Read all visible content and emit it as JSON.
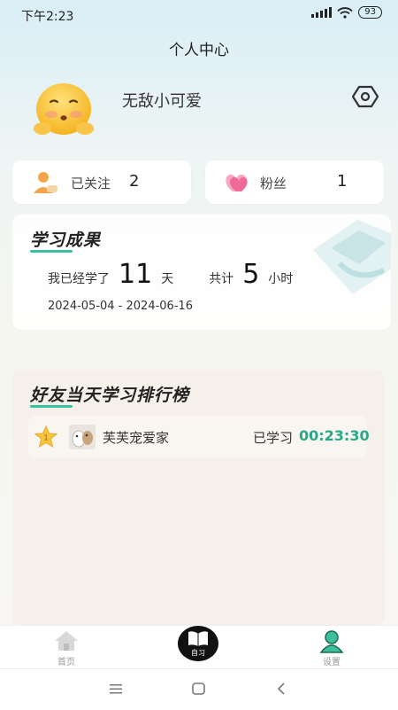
{
  "status_bar": {
    "time": "下午2:23",
    "battery": "93"
  },
  "page": {
    "title": "个人中心"
  },
  "profile": {
    "nickname": "无敌小可爱",
    "avatar_icon": "emoji-face-avatar",
    "settings_icon": "hexagon-gear-icon"
  },
  "stats": {
    "follow": {
      "label": "已关注",
      "count": "2",
      "icon": "user-icon"
    },
    "fans": {
      "label": "粉丝",
      "count": "1",
      "icon": "heart-icon"
    }
  },
  "study": {
    "title": "学习成果",
    "learned_prefix": "我已经学了",
    "days": "11",
    "days_unit": "天",
    "total_prefix": "共计",
    "hours": "5",
    "hours_unit": "小时",
    "date_range": "2024-05-04 - 2024-06-16"
  },
  "ranking": {
    "title": "好友当天学习排行榜",
    "entries": [
      {
        "rank": "1",
        "name": "芙芙宠爱家",
        "time_label": "已学习",
        "time": "00:23:30"
      }
    ]
  },
  "tabbar": {
    "home": "首页",
    "study": "自习",
    "settings": "设置"
  },
  "colors": {
    "accent": "#38c3a0",
    "time_green": "#2aa88a",
    "tab_active": "#3dbf9b"
  }
}
